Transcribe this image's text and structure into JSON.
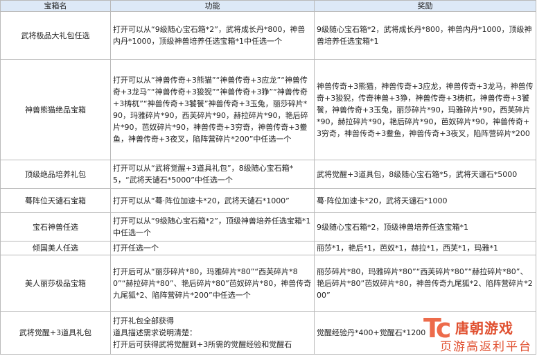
{
  "headers": [
    "宝箱名",
    "功能",
    "奖励"
  ],
  "rows": [
    {
      "name": "武将极品大礼包任选",
      "func": "打开可以从“9级随心宝石箱*2”，武将成长丹*800，神兽内丹*1000，顶级神兽培养任选宝箱*1中任选一个",
      "reward": "9级随心宝石箱*2，武将成长丹*800，神兽内丹*1000，顶级神兽培养任选宝箱*1"
    },
    {
      "name": "神兽熊猫绝品宝箱",
      "func": "打开可以从“神兽传奇+3熊猫”“神兽传奇+3应龙”“神兽传奇+3龙马”“神兽传奇+3狻猊”“神兽传奇+3狰”“神兽传奇+3梼杌”“神兽传奇+3饕餮”神兽传奇+3玉兔，丽莎碎片*90，玛雅碎片*90，西芙碎片*90，赫拉碎片*90，艳后碎片*90，芭奴碎片*90，神兽传奇+3穷奇，神兽传奇+3鲞鱼，神兽传奇+3夜叉，陷阵营碎片*200”中任选一个",
      "reward": "神兽传奇+3熊猫，神兽传奇+3应龙，神兽传奇+3龙马，神兽传奇+3狻猊，传奇神兽+3狰，神兽传奇+3梼杌，神兽传奇+3饕餮，神兽传奇+3玉兔，丽莎碎片*90，玛雅碎片*90，西芙碎片*90，赫拉碎片*90，艳后碎片*90，芭奴碎片*90，神兽传奇+3穷奇，神兽传奇+3鲞鱼，神兽传奇+3夜叉，陷阵营碎片*200"
    },
    {
      "name": "顶级绝品培养礼包",
      "func": "打开可以从“武将觉醒+3道具礼包”，8级随心宝石箱*5，“武将天谴石*5000”中任选一个",
      "reward": "武将觉醒+3道具包，8级随心宝石箱*5，武将天谴石*5000"
    },
    {
      "name": "蓦阵位天谴石宝箱",
      "func": "打开可以从“蓦·阵位加速卡*20，武将天谴石*1000”",
      "reward": "蓦·阵位加速卡*20，武将天谴石*1000"
    },
    {
      "name": "宝石神兽任选",
      "func": "打开可以从“9级随心宝石箱*2”，顶级神兽培养任选宝箱*1中任选一个",
      "reward": "9级随心宝石箱*2，顶级神兽培养任选宝箱*1"
    },
    {
      "name": "倾国美人任选",
      "func": "打开任选一个",
      "reward": "丽莎*1，艳后*1，芭奴*1，赫拉*1，西芙*1，玛雅*1"
    },
    {
      "name": "美人丽莎极品宝箱",
      "func": "打开后可从“丽莎碎片*80，玛雅碎片*80”“西芙碎片*80”“赫拉碎片*80”、艳后碎片*80”芭奴碎片*80，神兽传奇九尾狐*2、陷阵营碎片*200”中任选一个",
      "reward": "丽莎碎片*80，玛雅碎片*80”“西芙碎片*80”“赫拉碎片*80”、艳后碎片*80”芭奴碎片*80，神兽传奇九尾狐*2、陷阵营碎片*200”"
    },
    {
      "name": "武将觉醒+3道具礼包",
      "func": "打开礼包全部获得\n道具描述需求说明清楚：\n打开后可获得武将觉醒到+3所需的觉醒经验和觉醒石",
      "reward": "觉醒经验丹*400+觉醒石*1200"
    }
  ],
  "watermark": {
    "logo": "Tc",
    "name": "唐朝游戏",
    "slogan": "页游高返利平台"
  }
}
